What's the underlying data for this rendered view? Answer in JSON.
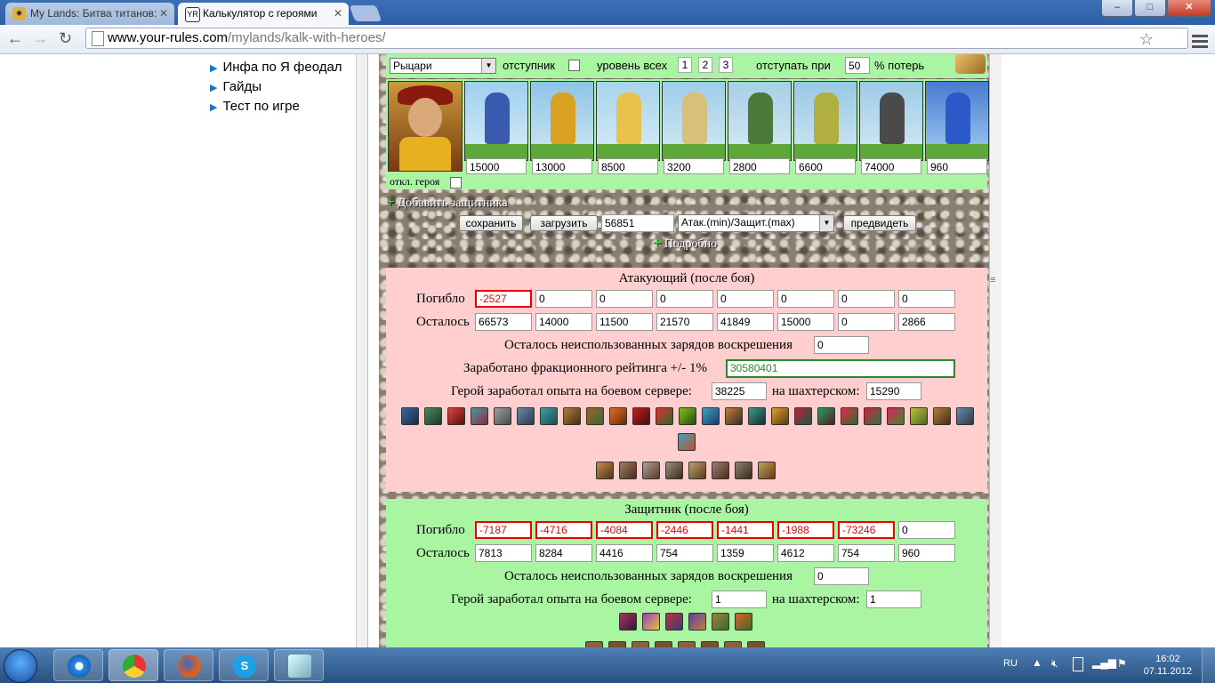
{
  "browser": {
    "tabs": [
      {
        "title": "My Lands: Битва титанов:",
        "active": false
      },
      {
        "title": "Калькулятор с героями",
        "active": true
      }
    ],
    "window_buttons": {
      "minimize": "–",
      "maximize": "□",
      "close": "✕"
    },
    "url_host": "www.your-rules.com",
    "url_path": "/mylands/kalk-with-heroes/"
  },
  "sidenav": {
    "items": [
      "Инфа по Я феодал",
      "Гайды",
      "Тест по игре"
    ]
  },
  "config": {
    "faction_select": "Рыцари",
    "deserter_label": "отступник",
    "level_all_label": "уровень всех",
    "levels": [
      "1",
      "2",
      "3"
    ],
    "retreat_label": "отступать при",
    "retreat_value": "50",
    "loss_label": "% потерь"
  },
  "army": {
    "hero_off_label": "откл. героя",
    "units": [
      "15000",
      "13000",
      "8500",
      "3200",
      "2800",
      "6600",
      "74000",
      "960"
    ]
  },
  "add_defender_label": "Добавить защитника",
  "actions": {
    "save": "сохранить",
    "load": "загрузить",
    "code": "56851",
    "mode_select": "Атак.(min)/Защит.(max)",
    "predict": "предвидеть",
    "details": "Подробно"
  },
  "attacker": {
    "title": "Атакующий (после боя)",
    "died_label": "Погибло",
    "died": [
      "-2527",
      "0",
      "0",
      "0",
      "0",
      "0",
      "0",
      "0"
    ],
    "left_label": "Осталось",
    "left": [
      "66573",
      "14000",
      "11500",
      "21570",
      "41849",
      "15000",
      "0",
      "2866"
    ],
    "resurrect_label": "Осталось неиспользованных зарядов воскрешения",
    "resurrect_value": "0",
    "rating_label": "Заработано фракционного рейтинга +/- 1%",
    "rating_value": "30580401",
    "exp_label": "Герой заработал опыта на боевом сервере:",
    "exp_value": "38225",
    "mine_label": "на шахтерском:",
    "mine_value": "15290"
  },
  "defender": {
    "title": "Защитник (после боя)",
    "died_label": "Погибло",
    "died": [
      "-7187",
      "-4716",
      "-4084",
      "-2446",
      "-1441",
      "-1988",
      "-73246",
      "0"
    ],
    "left_label": "Осталось",
    "left": [
      "7813",
      "8284",
      "4416",
      "754",
      "1359",
      "4612",
      "754",
      "960"
    ],
    "resurrect_label": "Осталось неиспользованных зарядов воскрешения",
    "resurrect_value": "0",
    "exp_label": "Герой заработал опыта на боевом сервере:",
    "exp_value": "1",
    "mine_label": "на шахтерском:",
    "mine_value": "1"
  },
  "taskbar": {
    "lang": "RU",
    "time": "16:02",
    "date": "07.11.2012"
  },
  "colors": {
    "green_panel": "#aaf5a2",
    "pink_panel": "#ffcfd0",
    "loss_red": "#e00000",
    "rating_green": "#2a8a2a"
  }
}
